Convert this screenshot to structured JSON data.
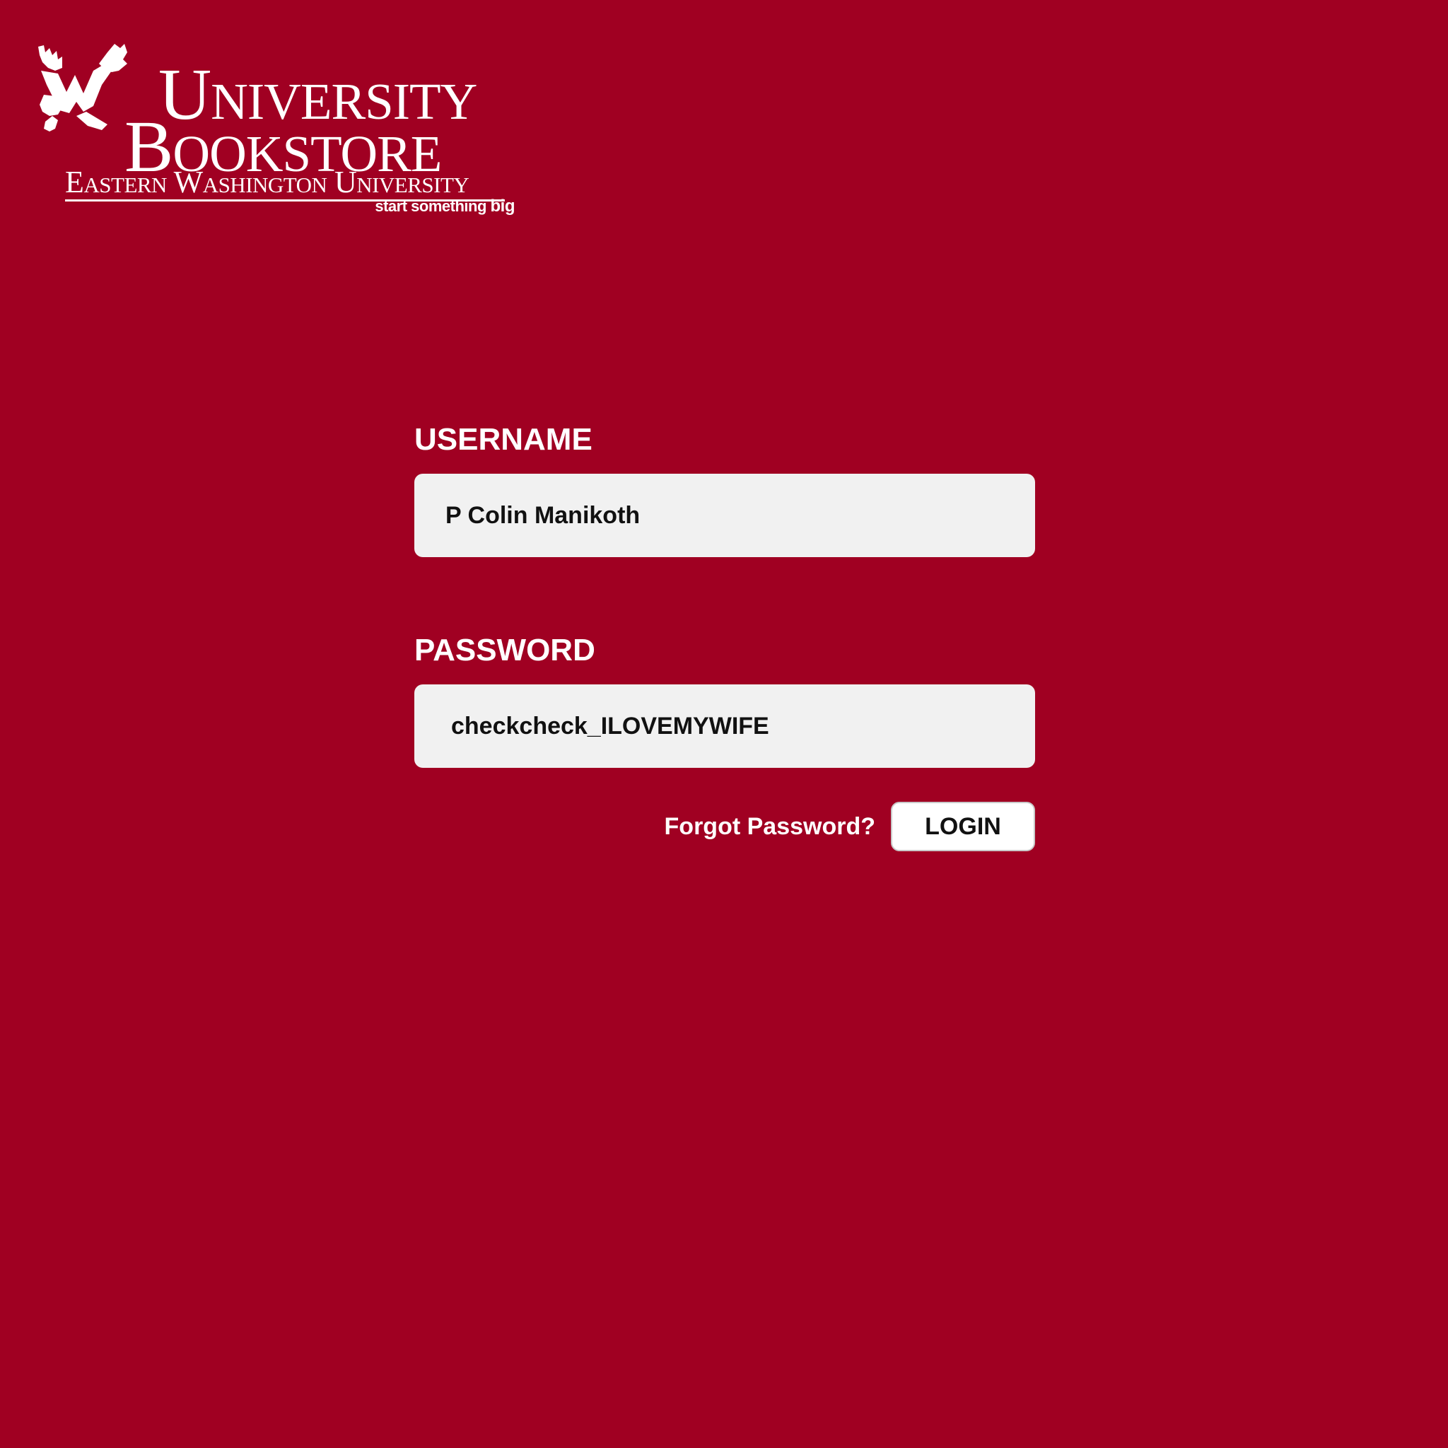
{
  "brand": {
    "line1": "University",
    "line2": "Bookstore",
    "line3": "Eastern Washington University",
    "tagline_prefix": "start something ",
    "tagline_emphasis": "big",
    "logo_icon": "eagle-icon"
  },
  "login_form": {
    "username_label": "USERNAME",
    "username_value": "P Colin Manikoth",
    "password_label": "PASSWORD",
    "password_value": "checkcheck_ILOVEMYWIFE",
    "forgot_password_label": "Forgot Password?",
    "login_button_label": "LOGIN"
  },
  "colors": {
    "background": "#a00022",
    "input_background": "#f1f1f1",
    "text_light": "#ffffff",
    "text_dark": "#111111"
  }
}
